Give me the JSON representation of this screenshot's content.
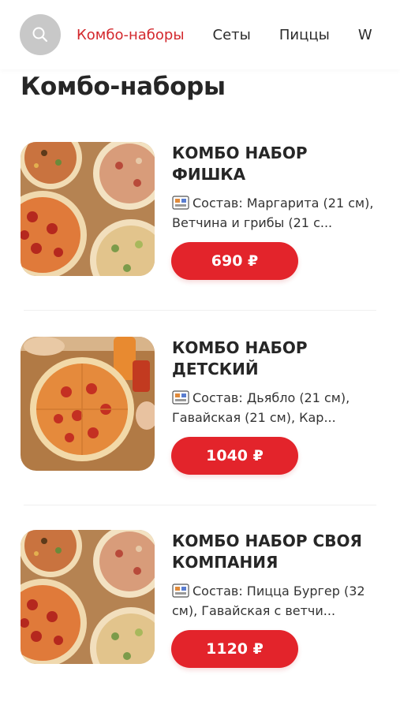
{
  "nav": {
    "items": [
      {
        "label": "Комбо-наборы",
        "active": true
      },
      {
        "label": "Сеты",
        "active": false
      },
      {
        "label": "Пиццы",
        "active": false
      },
      {
        "label": "W",
        "active": false
      }
    ]
  },
  "page": {
    "title": "Комбо-наборы"
  },
  "products": [
    {
      "title": "КОМБО НАБОР ФИШКА",
      "description": "Состав: Маргарита (21 см), Ветчина и грибы (21 с...",
      "price": "690 ₽",
      "image": "pizza-set-photo"
    },
    {
      "title": "КОМБО НАБОР ДЕТСКИЙ",
      "description": "Состав: Дьябло (21 см), Гавайская (21 см), Кар...",
      "price": "1040 ₽",
      "image": "pizza-on-table-photo"
    },
    {
      "title": "КОМБО НАБОР СВОЯ КОМПАНИЯ",
      "description": "Состав: Пицца Бургер (32 см), Гавайская с ветчи...",
      "price": "1120 ₽",
      "image": "pizza-set-photo"
    }
  ],
  "colors": {
    "accent": "#e3242b",
    "active_nav": "#d3282d",
    "search_bg": "#c8c8c8"
  },
  "icons": {
    "search": "search-icon",
    "menu": "menu-card-icon"
  }
}
